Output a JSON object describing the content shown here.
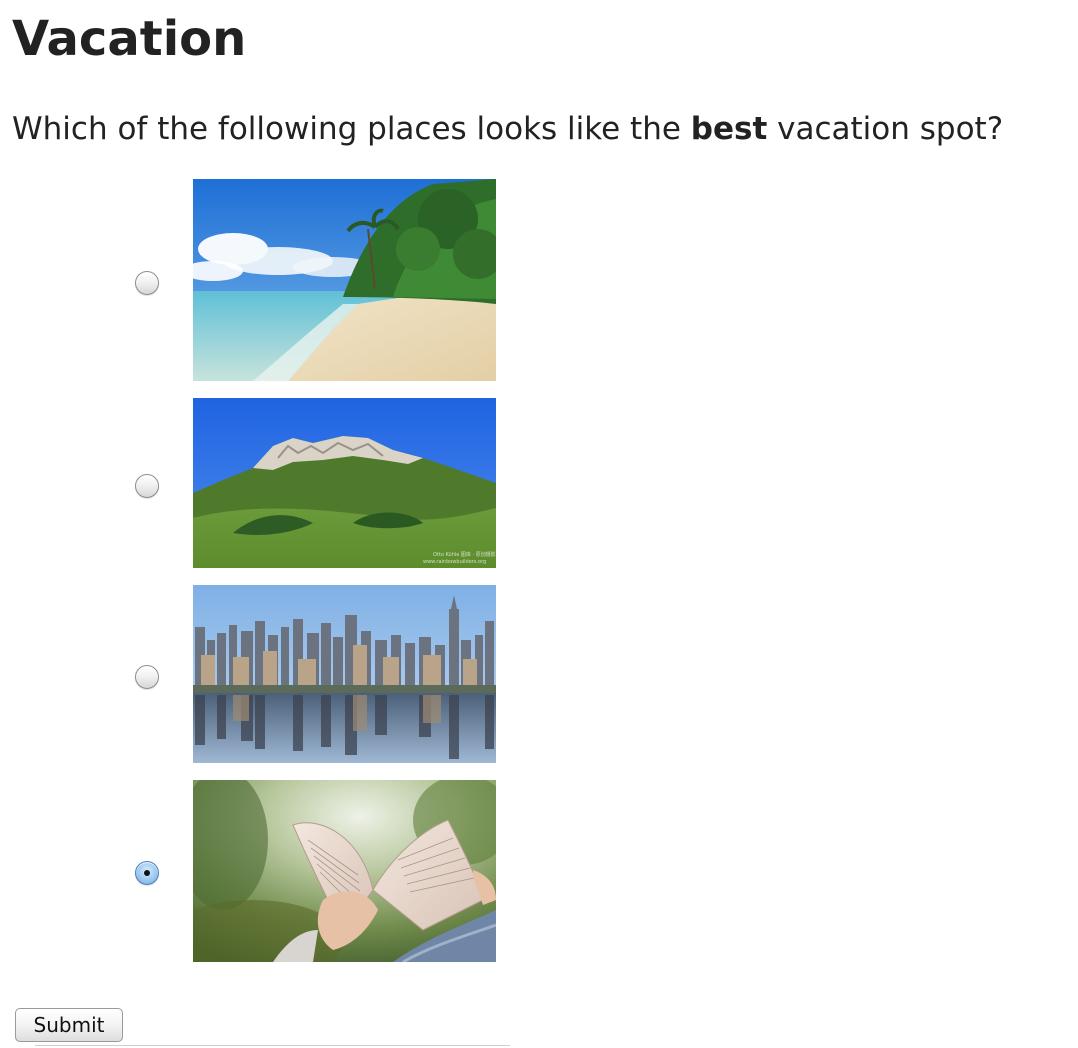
{
  "page": {
    "title": "Vacation",
    "question": {
      "prefix": "Which of the following places looks like the ",
      "emphasis": "best",
      "suffix": " vacation spot?"
    }
  },
  "options": [
    {
      "photo_icon": "beach-photo",
      "selected": false
    },
    {
      "photo_icon": "mountain-photo",
      "selected": false
    },
    {
      "photo_icon": "city-skyline-photo",
      "selected": false
    },
    {
      "photo_icon": "reading-book-photo",
      "selected": true
    }
  ],
  "mountain_watermark": {
    "line1": "Otto Kühle 图库 · 原创摄影",
    "line2": "www.rainbowbuilders.org"
  },
  "form": {
    "submit_label": "Submit"
  },
  "colors": {
    "text": "#222222",
    "radio_selected": "#6ea9de",
    "sky_blue": "#2f7be0"
  }
}
